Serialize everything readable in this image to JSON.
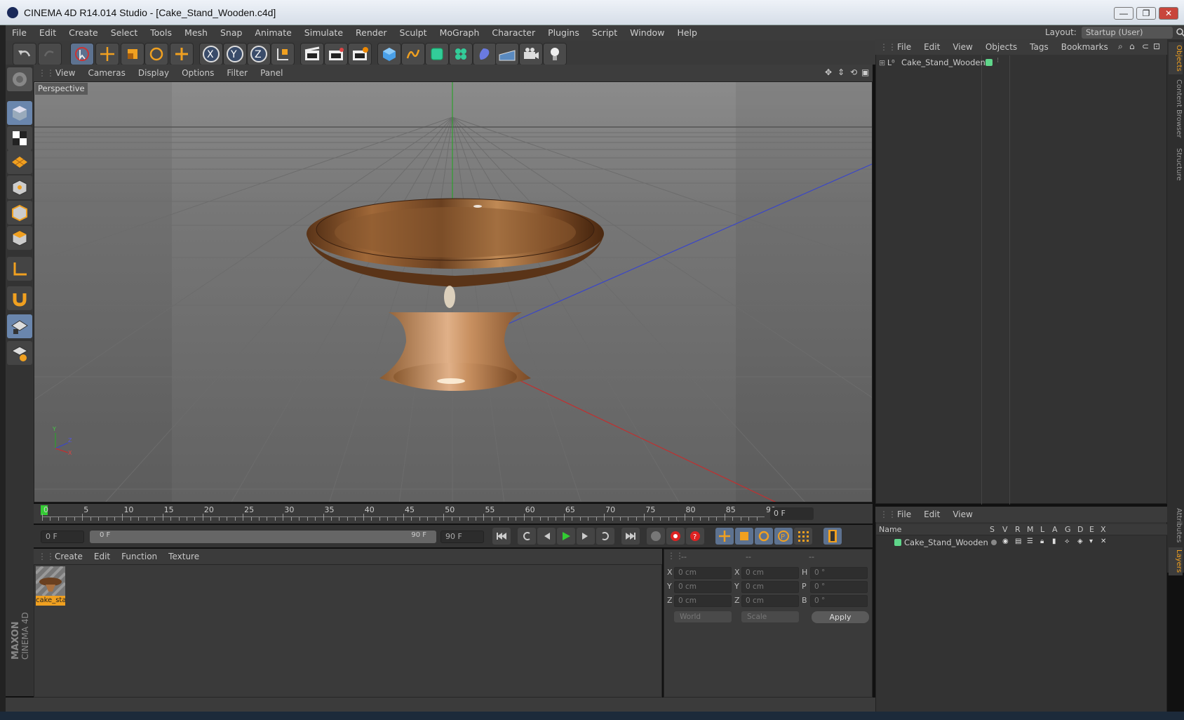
{
  "window": {
    "title": "CINEMA 4D R14.014 Studio - [Cake_Stand_Wooden.c4d]",
    "controls": [
      "—",
      "❐",
      "✕"
    ]
  },
  "menubar": {
    "items": [
      "File",
      "Edit",
      "Create",
      "Select",
      "Tools",
      "Mesh",
      "Snap",
      "Animate",
      "Simulate",
      "Render",
      "Sculpt",
      "MoGraph",
      "Character",
      "Plugins",
      "Script",
      "Window",
      "Help"
    ],
    "layout_label": "Layout:",
    "layout_value": "Startup (User)"
  },
  "viewport": {
    "menu": [
      "View",
      "Cameras",
      "Display",
      "Options",
      "Filter",
      "Panel"
    ],
    "label": "Perspective",
    "axis": {
      "x": "X",
      "y": "Y",
      "z": "Z"
    }
  },
  "timeline": {
    "ticks": [
      "0",
      "5",
      "10",
      "15",
      "20",
      "25",
      "30",
      "35",
      "40",
      "45",
      "50",
      "55",
      "60",
      "65",
      "70",
      "75",
      "80",
      "85",
      "90"
    ],
    "current_frame_field": "0 F",
    "start_field": "0 F",
    "range_start": "0 F",
    "range_end": "90 F",
    "end_field": "90 F"
  },
  "materials": {
    "menu": [
      "Create",
      "Edit",
      "Function",
      "Texture"
    ],
    "items": [
      {
        "label": "cake_sta"
      }
    ]
  },
  "coordinates": {
    "headers": [
      "--",
      "--",
      "--"
    ],
    "rows": [
      {
        "l1": "X",
        "v1": "0 cm",
        "l2": "X",
        "v2": "0 cm",
        "l3": "H",
        "v3": "0 °"
      },
      {
        "l1": "Y",
        "v1": "0 cm",
        "l2": "Y",
        "v2": "0 cm",
        "l3": "P",
        "v3": "0 °"
      },
      {
        "l1": "Z",
        "v1": "0 cm",
        "l2": "Z",
        "v2": "0 cm",
        "l3": "B",
        "v3": "0 °"
      }
    ],
    "mode": "World",
    "transform": "Scale",
    "apply": "Apply"
  },
  "objects": {
    "menu": [
      "File",
      "Edit",
      "View",
      "Objects",
      "Tags",
      "Bookmarks"
    ],
    "items": [
      {
        "name": "Cake_Stand_Wooden",
        "color": "#5fd68a"
      }
    ]
  },
  "layers": {
    "menu": [
      "File",
      "Edit",
      "View"
    ],
    "columns": [
      "Name",
      "S",
      "V",
      "R",
      "M",
      "L",
      "A",
      "G",
      "D",
      "E",
      "X"
    ],
    "items": [
      {
        "name": "Cake_Stand_Wooden",
        "color": "#5fd68a"
      }
    ]
  },
  "sidetabs": [
    "Objects",
    "Content Browser",
    "Structure",
    "Attributes",
    "Layers"
  ],
  "branding": {
    "maxon": "MAXON",
    "product": "CINEMA 4D"
  },
  "colors": {
    "accent": "#f0a020",
    "x_axis": "#c03030",
    "y_axis": "#30a030",
    "z_axis": "#3040c0"
  }
}
